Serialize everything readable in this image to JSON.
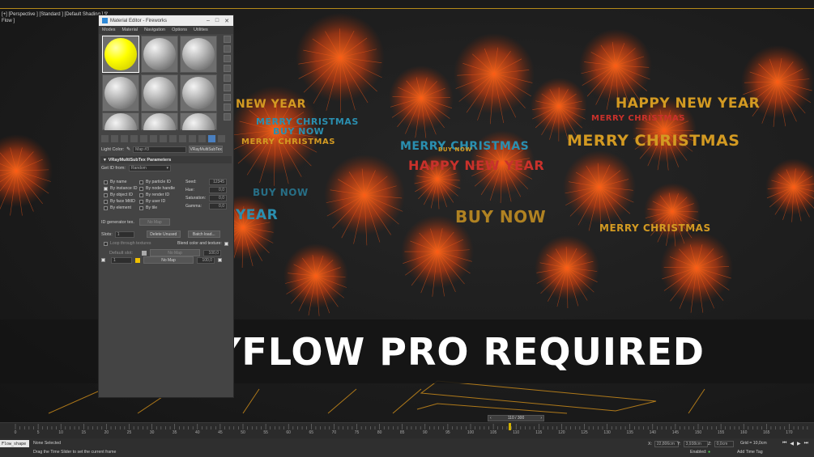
{
  "viewport": {
    "label": "[+] [Perspective ] [Standard ] [Default Shading ]  ∇",
    "sublabel": "Flow ]"
  },
  "scene_words": [
    {
      "text": "HAPPY NEW YEAR",
      "color": "yellow"
    },
    {
      "text": "MERRY CHRISTMAS",
      "color": "red"
    },
    {
      "text": "MERRY CHRISTMAS",
      "color": "yellow"
    },
    {
      "text": "NEW YEAR",
      "color": "yellow"
    },
    {
      "text": "MERRY CHRISTMAS",
      "color": "cyan"
    },
    {
      "text": "BUY NOW",
      "color": "cyan"
    },
    {
      "text": "MERRY CHRISTMAS",
      "color": "yellow"
    },
    {
      "text": "MERRY CHRISTMAS",
      "color": "cyan"
    },
    {
      "text": "BUY NOW",
      "color": "yellow"
    },
    {
      "text": "HAPPY NEW YEAR",
      "color": "red"
    },
    {
      "text": "BUY NOW",
      "color": "cyan"
    },
    {
      "text": "BUY NOW",
      "color": "yellow"
    },
    {
      "text": "YEAR",
      "color": "cyan"
    },
    {
      "text": "MERRY CHRISTMAS",
      "color": "yellow"
    }
  ],
  "banner": {
    "text": "NO TYFLOW PRO REQUIRED"
  },
  "material_editor": {
    "title": "Material Editor - Fireworks",
    "menu": [
      "Modes",
      "Material",
      "Navigation",
      "Options",
      "Utilities"
    ],
    "light_color_label": "Light Color:",
    "map_name": "Map #3",
    "map_type": "VRayMultiSubTex",
    "rollout_title": "VRayMultiSubTex Parameters",
    "get_id_label": "Get ID from:",
    "get_id_value": "Random",
    "options_left": [
      {
        "label": "By name",
        "checked": false
      },
      {
        "label": "By instance ID",
        "checked": true
      },
      {
        "label": "By object ID",
        "checked": false
      },
      {
        "label": "By face MtlID",
        "checked": false
      },
      {
        "label": "By element",
        "checked": false
      }
    ],
    "options_right": [
      {
        "label": "By particle ID",
        "checked": false
      },
      {
        "label": "By node handle",
        "checked": false
      },
      {
        "label": "By render ID",
        "checked": false
      },
      {
        "label": "By user ID",
        "checked": false
      },
      {
        "label": "By tile",
        "checked": false
      }
    ],
    "seed_label": "Seed:",
    "seed_value": "12345",
    "hue_label": "Hue:",
    "hue_value": "0,0",
    "saturation_label": "Saturation:",
    "saturation_value": "0,0",
    "gamma_label": "Gamma:",
    "gamma_value": "0,0",
    "id_gen_label": "ID generator tex.",
    "id_gen_value": "No Map",
    "slots_label": "Slots:",
    "slots_value": "1",
    "delete_unused_label": "Delete Unused",
    "batch_load_label": "Batch load...",
    "loop_label": "Loop through textures",
    "blend_label": "Blend color and texture:",
    "default_label": "Default slot:",
    "default_map": "No Map",
    "default_amount": "100,0",
    "slot1_index": "1",
    "slot1_map": "No Map",
    "slot1_amount": "100,0"
  },
  "timeline": {
    "frame_display": "110 / 300",
    "ticks": [
      "0",
      "5",
      "10",
      "15",
      "20",
      "25",
      "30",
      "35",
      "40",
      "45",
      "50",
      "55",
      "60",
      "65",
      "70",
      "75",
      "80",
      "85",
      "90",
      "95",
      "100",
      "105",
      "110",
      "115",
      "120",
      "125",
      "130",
      "135",
      "140",
      "145",
      "150",
      "155",
      "160",
      "165",
      "170"
    ]
  },
  "status": {
    "command_field": "Flow_shape",
    "selection": "None Selected",
    "prompt": "Drag the Time Slider to set the current frame",
    "x_label": "X:",
    "x_value": "22,806cm",
    "y_label": "Y:",
    "y_value": "3,938cm",
    "z_label": "Z:",
    "z_value": "0,0cm",
    "grid": "Grid = 10,0cm",
    "enabled_label": "Enabled:",
    "add_time_tag": "Add Time Tag"
  },
  "colors": {
    "firework": "#e04a12",
    "banner_bg": "#141414",
    "accent_yellow": "#d39a22",
    "accent_red": "#c9312b",
    "accent_cyan": "#2a8fb0"
  }
}
